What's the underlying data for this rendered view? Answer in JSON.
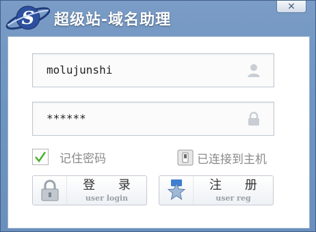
{
  "window": {
    "title": "超级站-域名助理",
    "close_label": "✕"
  },
  "login": {
    "username_value": "molujunshi",
    "password_value": "******",
    "remember_label": "记住密码",
    "remember_checked": true,
    "status_label": "已连接到主机",
    "login_button": {
      "zh": "登 录",
      "en": "user login"
    },
    "register_button": {
      "zh": "注 册",
      "en": "user reg"
    }
  },
  "icons": {
    "logo": "saturn-s-logo-icon",
    "user": "user-icon",
    "lock": "lock-icon",
    "check": "check-icon",
    "connection": "switch-icon",
    "login": "padlock-icon",
    "register": "star-badge-icon"
  },
  "colors": {
    "title_bar": "#6f95c2",
    "content_bg": "#ffffff",
    "check_green": "#4caf2f"
  }
}
